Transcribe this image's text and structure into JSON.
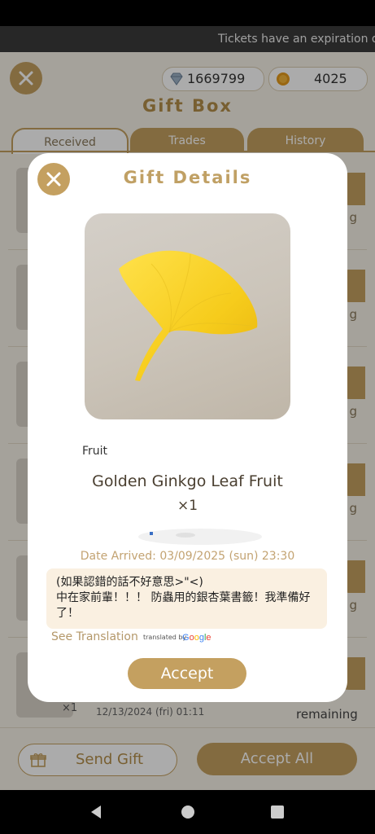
{
  "ticker": {
    "text": "Tickets have an expiration date"
  },
  "header": {
    "title": "Gift Box",
    "diamonds": "1669799",
    "coins": "4025"
  },
  "tabs": [
    {
      "label": "Received"
    },
    {
      "label": "Trades"
    },
    {
      "label": "History"
    }
  ],
  "list": {
    "row_tail": "g",
    "last_row": {
      "qty": "×1",
      "date": "12/13/2024 (fri) 01:11",
      "remaining": "remaining"
    }
  },
  "footer": {
    "send_gift_label": "Send Gift",
    "accept_all_label": "Accept All"
  },
  "modal": {
    "title": "Gift Details",
    "category": "Fruit",
    "gift_name": "Golden Ginkgo Leaf Fruit",
    "quantity": "×1",
    "date_arrived": "Date Arrived: 03/09/2025 (sun) 23:30",
    "message": "(如果認錯的話不好意思>\"<)\n中在家前輩！！！ 防蟲用的銀杏葉書籤！我準備好了！",
    "see_translation": "See Translation",
    "translated_by": "translated by",
    "google": "Google",
    "accept_label": "Accept"
  },
  "colors": {
    "gold": "#c4a060",
    "title_gold": "#c0a064",
    "date_text": "#c3a372",
    "message_bg": "#faf0e1",
    "leaf_yellow": "#f5cf1e"
  },
  "icons": [
    "close-icon",
    "diamond-icon",
    "coin-icon",
    "gift-icon",
    "ginkgo-leaf",
    "back-icon",
    "home-icon",
    "recents-icon"
  ]
}
